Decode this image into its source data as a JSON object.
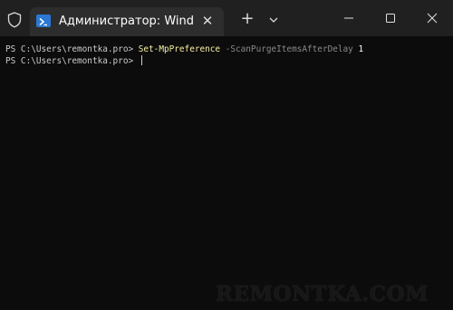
{
  "tab": {
    "title": "Администратор: Windows"
  },
  "terminal": {
    "lines": [
      {
        "prompt": "PS C:\\Users\\remontka.pro> ",
        "command": "Set-MpPreference",
        "parameter": " -ScanPurgeItemsAfterDelay",
        "value": " 1"
      },
      {
        "prompt": "PS C:\\Users\\remontka.pro> "
      }
    ]
  },
  "watermark": "REMONTKA.COM",
  "colors": {
    "titlebar": "#202020",
    "tab": "#2d2d2d",
    "terminal_bg": "#0c0c0c",
    "command": "#f9f1a5",
    "parameter": "#8a8a8a",
    "text": "#cccccc"
  }
}
